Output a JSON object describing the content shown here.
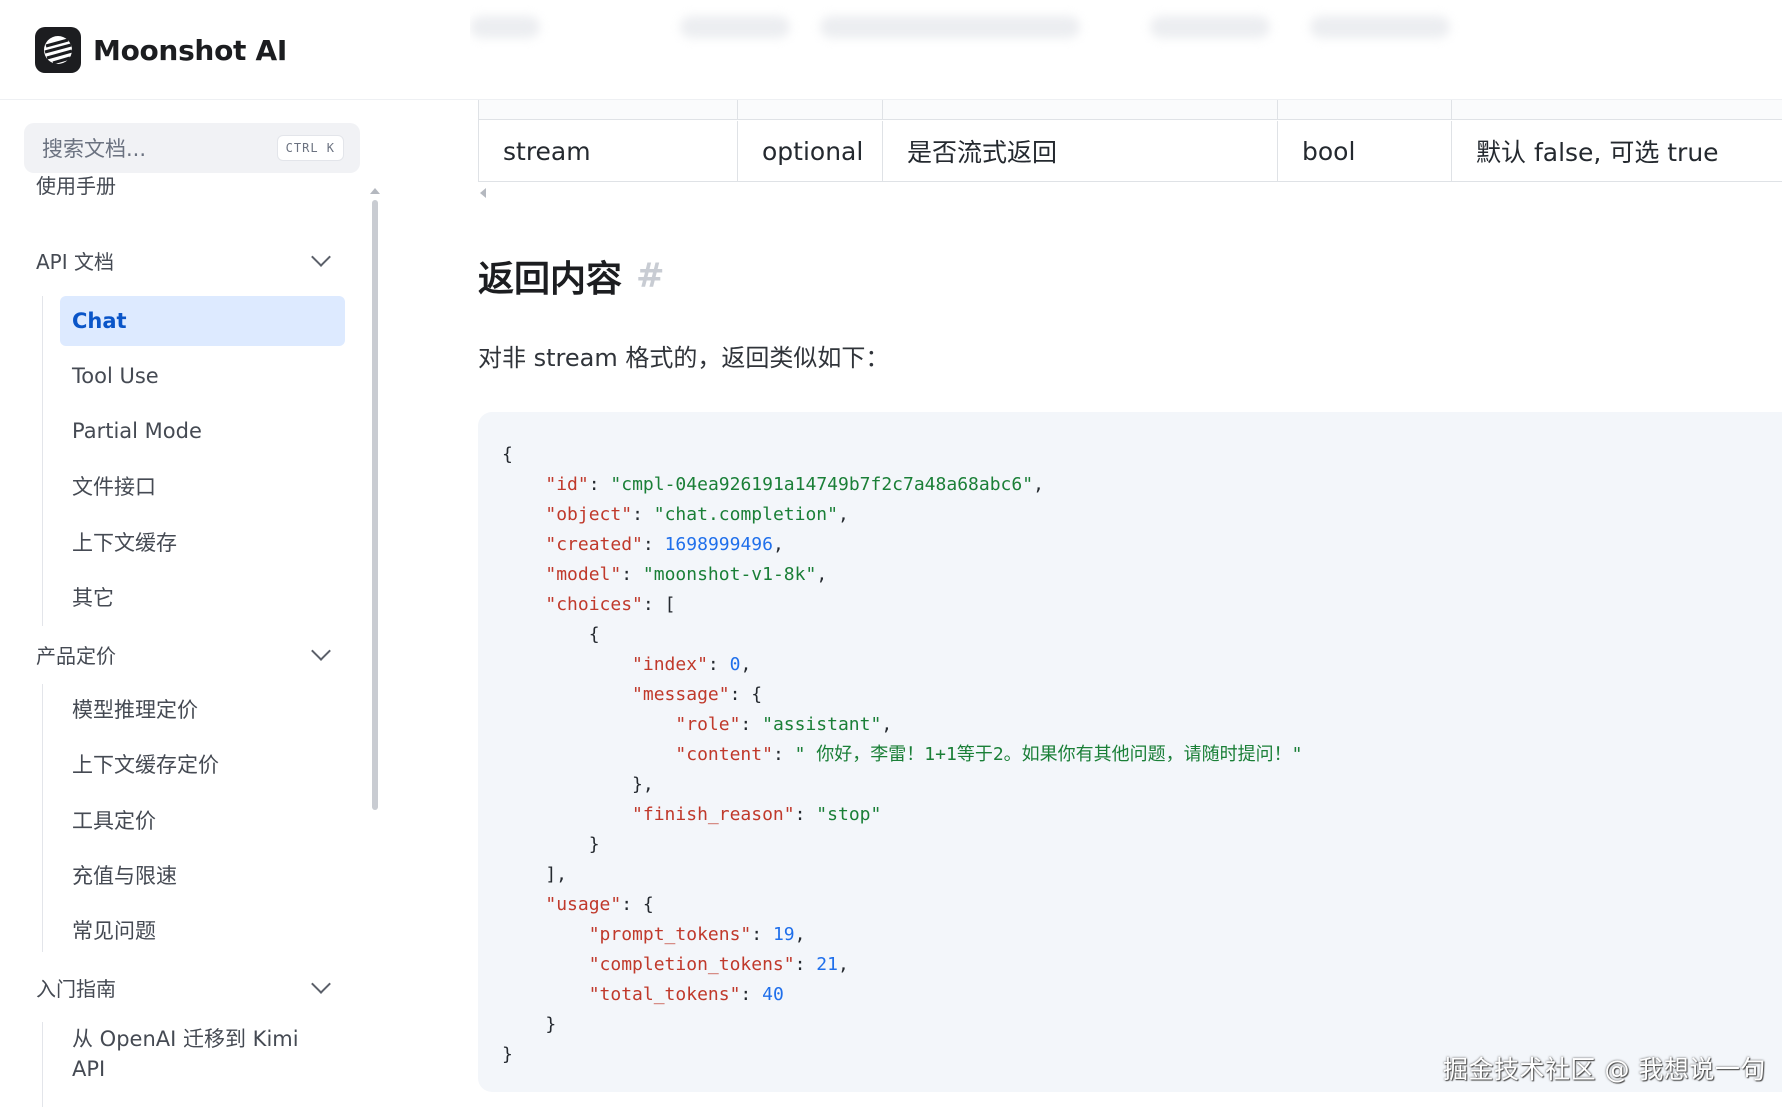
{
  "header": {
    "logo_text": "Moonshot AI"
  },
  "search": {
    "placeholder": "搜索文档...",
    "shortcut": "CTRL K"
  },
  "sidebar": {
    "sections": [
      {
        "label": "使用手册",
        "expandable": false
      },
      {
        "label": "API 文档",
        "expandable": true,
        "items": [
          "Chat",
          "Tool Use",
          "Partial Mode",
          "文件接口",
          "上下文缓存",
          "其它"
        ],
        "active": "Chat"
      },
      {
        "label": "产品定价",
        "expandable": true,
        "items": [
          "模型推理定价",
          "上下文缓存定价",
          "工具定价",
          "充值与限速",
          "常见问题"
        ]
      },
      {
        "label": "入门指南",
        "expandable": true,
        "items": [
          "从 OpenAI 迁移到 Kimi API"
        ]
      }
    ]
  },
  "table": {
    "row": [
      "stream",
      "optional",
      "是否流式返回",
      "bool",
      "默认 false, 可选 true"
    ]
  },
  "content": {
    "section_title": "返回内容",
    "anchor": "#",
    "description": "对非 stream 格式的，返回类似如下："
  },
  "code": {
    "id": "cmpl-04ea926191a14749b7f2c7a48a68abc6",
    "object": "chat.completion",
    "created": "1698999496",
    "model": "moonshot-v1-8k",
    "index": "0",
    "role": "assistant",
    "content": " 你好，李雷！1+1等于2。如果你有其他问题，请随时提问！",
    "finish_reason": "stop",
    "prompt_tokens": "19",
    "completion_tokens": "21",
    "total_tokens": "40"
  },
  "watermark": "掘金技术社区 @ 我想说一句",
  "colors": {
    "active_nav_bg": "#ddeaff",
    "active_nav_text": "#0a55c8",
    "code_bg": "#f3f6fa",
    "json_key": "#c0392b",
    "json_string": "#1a7f37",
    "json_number": "#1f6feb"
  }
}
